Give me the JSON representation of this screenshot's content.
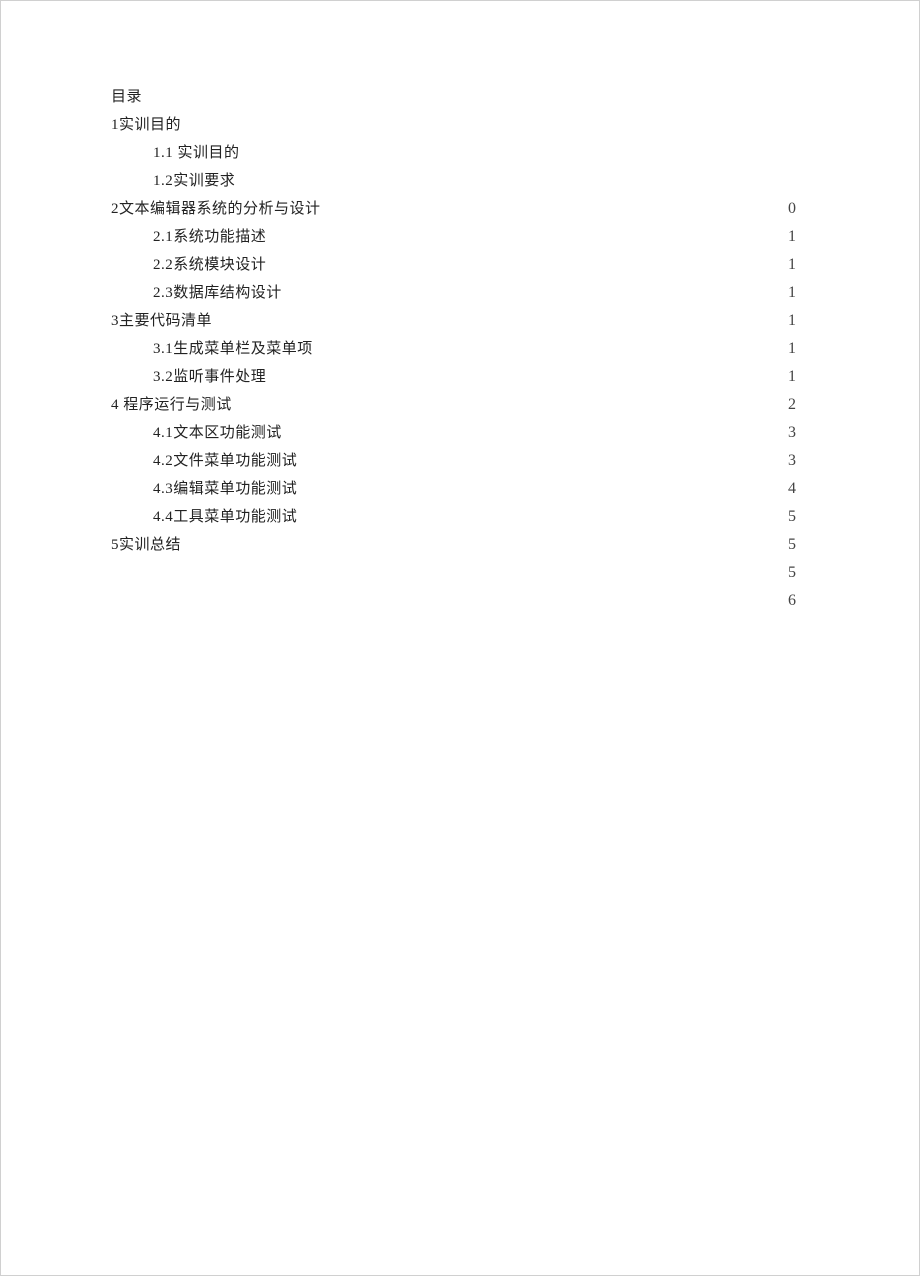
{
  "toc": [
    {
      "label": "目录",
      "level": 1
    },
    {
      "label": "1实训目的",
      "level": 1
    },
    {
      "label": "1.1 实训目的",
      "level": 2
    },
    {
      "label": "1.2实训要求",
      "level": 2
    },
    {
      "label": "2文本编辑器系统的分析与设计",
      "level": 1
    },
    {
      "label": "2.1系统功能描述",
      "level": 2
    },
    {
      "label": "2.2系统模块设计",
      "level": 2
    },
    {
      "label": "2.3数据库结构设计",
      "level": 2
    },
    {
      "label": "3主要代码清单",
      "level": 1
    },
    {
      "label": "3.1生成菜单栏及菜单项",
      "level": 2
    },
    {
      "label": "3.2监听事件处理",
      "level": 2
    },
    {
      "label": "4 程序运行与测试",
      "level": 1
    },
    {
      "label": "4.1文本区功能测试",
      "level": 2
    },
    {
      "label": "4.2文件菜单功能测试",
      "level": 2
    },
    {
      "label": "4.3编辑菜单功能测试",
      "level": 2
    },
    {
      "label": "4.4工具菜单功能测试",
      "level": 2
    },
    {
      "label": "5实训总结",
      "level": 1
    }
  ],
  "page_numbers": [
    "0",
    "1",
    "1",
    "1",
    "1",
    "1",
    "1",
    "2",
    "3",
    "3",
    "4",
    "5",
    "5",
    "5",
    "6"
  ]
}
